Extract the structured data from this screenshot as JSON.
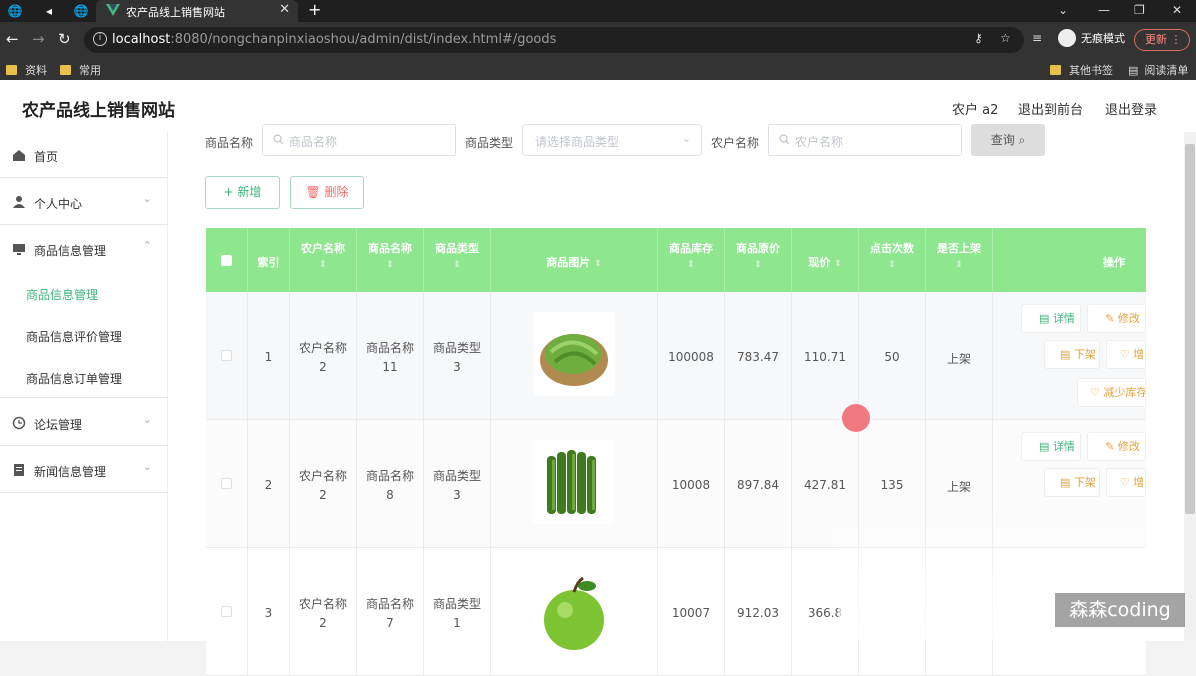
{
  "browser": {
    "tab_title": "农产品线上销售网站",
    "url_host": "localhost",
    "url_rest": ":8080/nongchanpinxiaoshou/admin/dist/index.html#/goods",
    "incognito_label": "无痕模式",
    "update_label": "更新",
    "bookmarks": [
      "资料",
      "常用"
    ],
    "bookmarks_right": [
      "其他书签",
      "阅读清单"
    ]
  },
  "header": {
    "brand": "农产品线上销售网站",
    "user": "农户 a2",
    "back_front": "退出到前台",
    "logout": "退出登录"
  },
  "sidebar": {
    "home": "首页",
    "personal": "个人中心",
    "goods_mgmt": "商品信息管理",
    "sub_goods": "商品信息管理",
    "sub_review": "商品信息评价管理",
    "sub_order": "商品信息订单管理",
    "forum": "论坛管理",
    "news": "新闻信息管理"
  },
  "search": {
    "name_label": "商品名称",
    "name_placeholder": "商品名称",
    "type_label": "商品类型",
    "type_placeholder": "请选择商品类型",
    "farmer_label": "农户名称",
    "farmer_placeholder": "农户名称",
    "query_label": "查询"
  },
  "actions": {
    "add": "新增",
    "delete": "删除"
  },
  "table": {
    "headers": {
      "index": "索引",
      "farmer": "农户名称",
      "name": "商品名称",
      "type": "商品类型",
      "image": "商品图片",
      "stock": "商品库存",
      "orig_price": "商品原价",
      "price": "现价",
      "clicks": "点击次数",
      "onshelf": "是否上架",
      "ops": "操作"
    },
    "rows": [
      {
        "index": "1",
        "farmer_a": "农户名称",
        "farmer_b": "2",
        "name_a": "商品名称",
        "name_b": "11",
        "type_a": "商品类型",
        "type_b": "3",
        "stock": "100008",
        "orig_price": "783.47",
        "price": "110.71",
        "clicks": "50",
        "onshelf": "上架"
      },
      {
        "index": "2",
        "farmer_a": "农户名称",
        "farmer_b": "2",
        "name_a": "商品名称",
        "name_b": "8",
        "type_a": "商品类型",
        "type_b": "3",
        "stock": "10008",
        "orig_price": "897.84",
        "price": "427.81",
        "clicks": "135",
        "onshelf": "上架"
      },
      {
        "index": "3",
        "farmer_a": "农户名称",
        "farmer_b": "2",
        "name_a": "商品名称",
        "name_b": "7",
        "type_a": "商品类型",
        "type_b": "1",
        "stock": "10007",
        "orig_price": "912.03",
        "price": "366.8",
        "clicks": "",
        "onshelf": ""
      }
    ],
    "op_labels": {
      "detail": "详情",
      "edit": "修改",
      "off": "下架",
      "more": "增",
      "decrease": "减少库存"
    }
  },
  "watermark": "森森coding"
}
